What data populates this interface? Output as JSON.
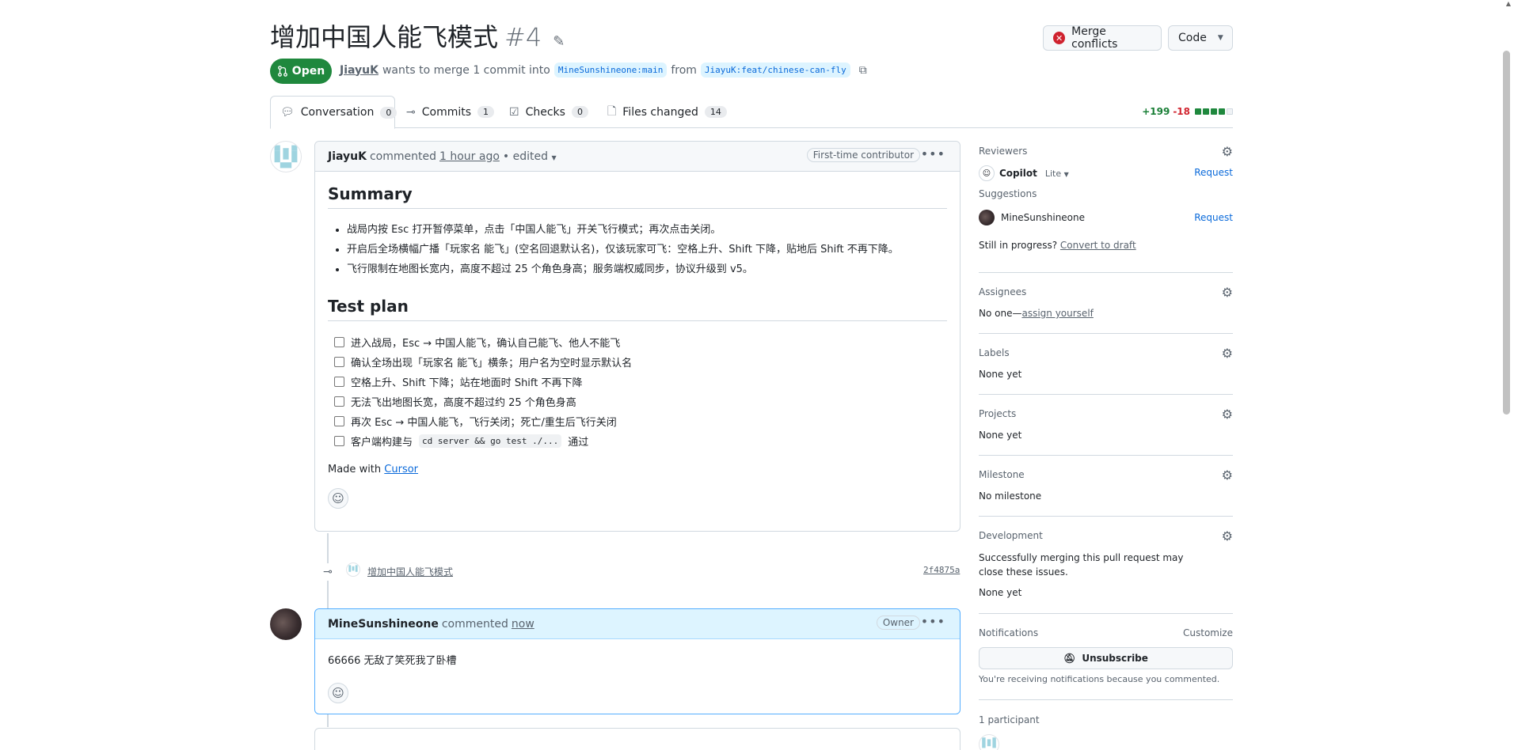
{
  "header": {
    "title": "增加中国人能飞模式",
    "number": "#4",
    "merge_conflicts_label": "Merge conflicts",
    "code_label": "Code"
  },
  "state": {
    "label": "Open",
    "author": "JiayuK",
    "text_wants": "wants to merge 1 commit into",
    "base_branch": "MineSunshineone:main",
    "text_from": "from",
    "head_branch": "JiayuK:feat/chinese-can-fly"
  },
  "tabs": [
    {
      "label": "Conversation",
      "count": "0"
    },
    {
      "label": "Commits",
      "count": "1"
    },
    {
      "label": "Checks",
      "count": "0"
    },
    {
      "label": "Files changed",
      "count": "14"
    }
  ],
  "diffstat": {
    "additions": "+199",
    "deletions": "-18"
  },
  "comment1": {
    "author": "JiayuK",
    "action": "commented",
    "time": "1 hour ago",
    "edited": "• edited",
    "badge": "First-time contributor",
    "summary_heading": "Summary",
    "summary_items": [
      "战局内按 Esc 打开暂停菜单，点击「中国人能飞」开关飞行模式；再次点击关闭。",
      "开启后全场横幅广播「玩家名 能飞」(空名回退默认名)，仅该玩家可飞：空格上升、Shift 下降，贴地后 Shift 不再下降。",
      "飞行限制在地图长宽内，高度不超过 25 个角色身高；服务端权威同步，协议升级到 v5。"
    ],
    "test_heading": "Test plan",
    "tasks": [
      "进入战局，Esc → 中国人能飞，确认自己能飞、他人不能飞",
      "确认全场出现「玩家名 能飞」横条；用户名为空时显示默认名",
      "空格上升、Shift 下降；站在地面时 Shift 不再下降",
      "无法飞出地图长宽，高度不超过约 25 个角色身高",
      "再次 Esc → 中国人能飞，飞行关闭；死亡/重生后飞行关闭"
    ],
    "task_last_prefix": "客户端构建与",
    "task_last_code": "cd server && go test ./...",
    "task_last_suffix": "通过",
    "made_with": "Made with",
    "made_with_link": "Cursor"
  },
  "commit": {
    "message": "增加中国人能飞模式",
    "sha": "2f4875a"
  },
  "comment2": {
    "author": "MineSunshineone",
    "action": "commented",
    "time": "now",
    "badge": "Owner",
    "text": "66666 无敌了笑死我了卧槽"
  },
  "sidebar": {
    "reviewers_title": "Reviewers",
    "copilot_name": "Copilot",
    "copilot_plan": "Lite",
    "request_label": "Request",
    "suggestions_title": "Suggestions",
    "suggested_user": "MineSunshineone",
    "in_progress_text": "Still in progress?",
    "convert_draft": "Convert to draft",
    "assignees_title": "Assignees",
    "assignees_none": "No one—",
    "assign_yourself": "assign yourself",
    "labels_title": "Labels",
    "labels_value": "None yet",
    "projects_title": "Projects",
    "projects_value": "None yet",
    "milestone_title": "Milestone",
    "milestone_value": "No milestone",
    "development_title": "Development",
    "development_text": "Successfully merging this pull request may close these issues.",
    "development_value": "None yet",
    "notifications_title": "Notifications",
    "customize": "Customize",
    "unsubscribe": "Unsubscribe",
    "notif_reason": "You're receiving notifications because you commented.",
    "participants": "1 participant"
  },
  "colors": {
    "open_green": "#1f883d",
    "link_blue": "#0969da",
    "danger_red": "#cf222e"
  }
}
